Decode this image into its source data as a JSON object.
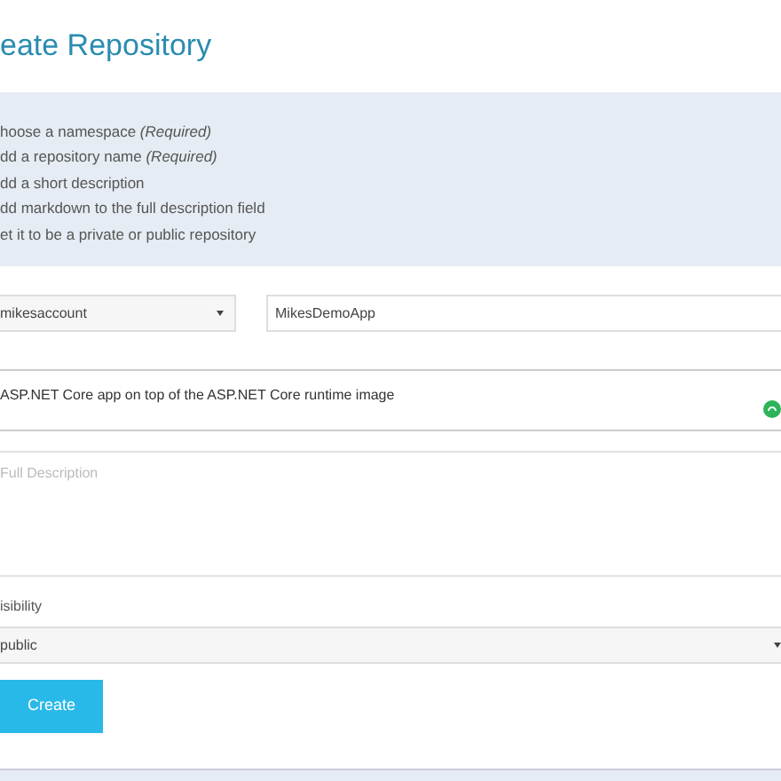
{
  "title": "eate Repository",
  "steps": [
    "hoose a namespace *(Required)*",
    "dd a repository name *(Required)*",
    "dd a short description",
    "dd markdown to the full description field",
    "et it to be a private or public repository"
  ],
  "namespace_select": {
    "value": "mikesaccount"
  },
  "name_field": {
    "value": "MikesDemoApp"
  },
  "short_description": {
    "value": "ASP.NET Core app on top of the ASP.NET Core runtime image"
  },
  "full_description": {
    "placeholder": "Full Description"
  },
  "visibility": {
    "label": "isibility",
    "value": "public"
  },
  "create_button": "Create"
}
